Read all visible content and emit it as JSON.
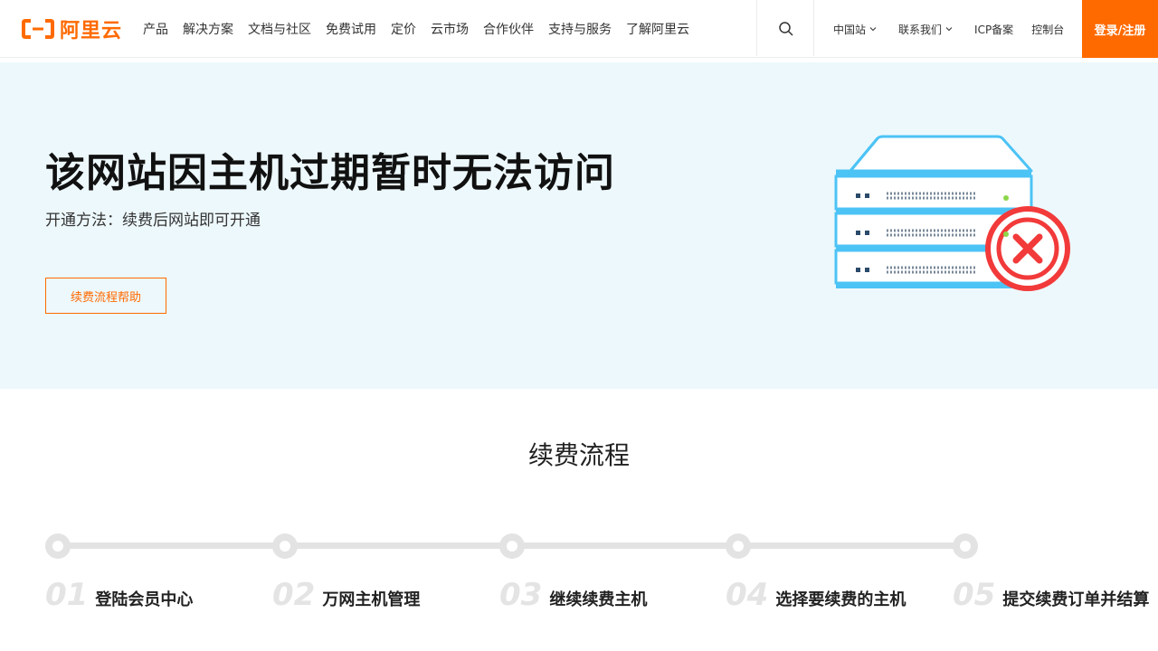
{
  "header": {
    "logo_text": "阿里云",
    "nav": [
      "产品",
      "解决方案",
      "文档与社区",
      "免费试用",
      "定价",
      "云市场",
      "合作伙伴",
      "支持与服务",
      "了解阿里云"
    ],
    "search_icon": "search-icon",
    "right_links": {
      "region": "中国站",
      "contact": "联系我们",
      "icp": "ICP备案",
      "console": "控制台"
    },
    "login_label": "登录/注册",
    "colors": {
      "brand": "#ff6a00"
    }
  },
  "hero": {
    "title": "该网站因主机过期暂时无法访问",
    "subtitle": "开通方法：续费后网站即可开通",
    "button_label": "续费流程帮助",
    "illustration": "server-error-icon",
    "background": "#edf8fc"
  },
  "process": {
    "title": "续费流程",
    "steps": [
      {
        "num": "01",
        "label": "登陆会员中心"
      },
      {
        "num": "02",
        "label": "万网主机管理"
      },
      {
        "num": "03",
        "label": "继续续费主机"
      },
      {
        "num": "04",
        "label": "选择要续费的主机"
      },
      {
        "num": "05",
        "label": "提交续费订单并结算"
      }
    ]
  }
}
